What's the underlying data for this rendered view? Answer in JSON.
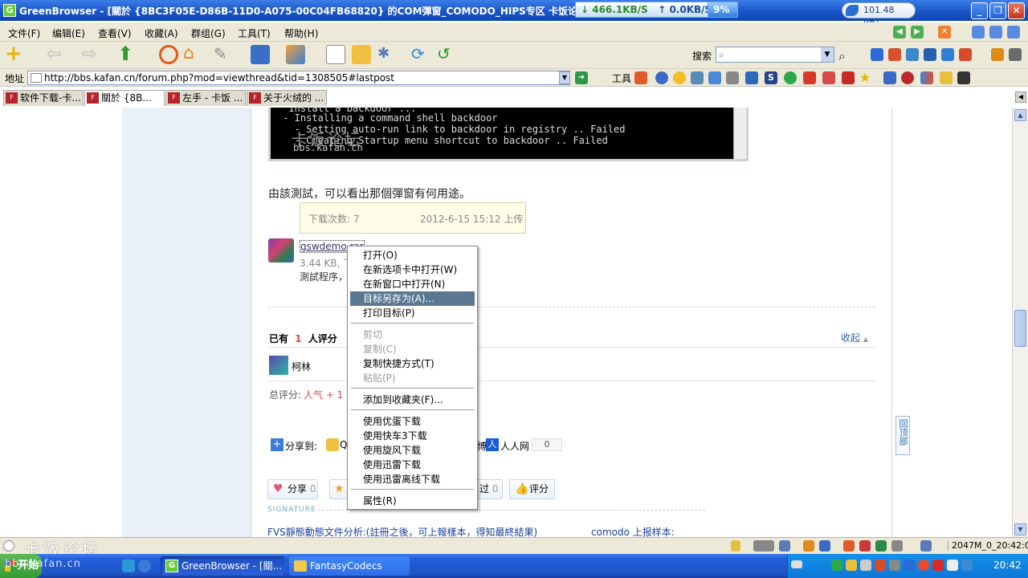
{
  "title_bar": {
    "text": "GreenBrowser - [關於 {8BC3F05E-D86B-11D0-A075-00C04FB68820} 的COM彈窗_COMODO_HIPS专区 卡饭论坛 - 互助分享,大",
    "download_speed": "↓ 466.1KB/S",
    "upload_speed": "↑ 0.0KB/S",
    "cpu": "9%",
    "net_meter": "101.48 KB/s"
  },
  "menu": [
    "文件(F)",
    "编辑(E)",
    "查看(V)",
    "收藏(A)",
    "群组(G)",
    "工具(T)",
    "帮助(H)"
  ],
  "search": {
    "label": "搜索",
    "value": ""
  },
  "address": {
    "label": "地址",
    "url": "http://bbs.kafan.cn/forum.php?mod=viewthread&tid=1308505#lastpost",
    "tools_label": "工具"
  },
  "tabs": [
    {
      "label": "软件下载-卡...",
      "active": false
    },
    {
      "label": "關於 {8B...",
      "active": true
    },
    {
      "label": "左手 - 卡饭 ...",
      "active": false
    },
    {
      "label": "关于火绒的 ...",
      "active": false
    }
  ],
  "console": {
    "lines": [
      "  Install a backdoor ...",
      " - Installing a command shell backdoor",
      "   - Setting auto-run link to backdoor in registry .. Failed",
      "   - Creating Startup menu shortcut to backdoor .. Failed"
    ],
    "watermark": "卡饭论坛",
    "watermark_url": "bbs.kafan.cn"
  },
  "post": {
    "text": "由該測試，可以看出那個彈窗有何用途。",
    "tooltip_downloads": "下载次数: 7",
    "tooltip_date": "2012-6-15 15:12 上传",
    "attachment_name": "gswdemo.rar",
    "attachment_meta": "3.44 KB, 下",
    "attachment_desc": "測試程序，"
  },
  "rating": {
    "prefix": "已有",
    "count": "1",
    "suffix": "人评分",
    "collapse": "收起",
    "user": "柯林",
    "total_label": "总评分:",
    "total_value": "人气 + 1"
  },
  "share": {
    "label": "分享到:",
    "qq": "Q",
    "partial": "博",
    "renren": "人人网",
    "renren_count": "0"
  },
  "actions": {
    "share": "分享",
    "share_count": "0",
    "pass_label": "过",
    "pass_count": "0",
    "rate": "评分"
  },
  "signature_label": "SIGNATURE",
  "footer_links": [
    "FVS靜態動態文件分析:(註冊之後，可上報樣本，得知最終結果)",
    "comodo 上报样本:"
  ],
  "back_to_top": "回顶部",
  "context_menu": [
    {
      "label": "打开(O)",
      "state": "normal"
    },
    {
      "label": "在新选项卡中打开(W)",
      "state": "normal"
    },
    {
      "label": "在新窗口中打开(N)",
      "state": "normal"
    },
    {
      "label": "目标另存为(A)...",
      "state": "highlighted"
    },
    {
      "label": "打印目标(P)",
      "state": "normal"
    },
    {
      "label": "剪切",
      "state": "disabled"
    },
    {
      "label": "复制(C)",
      "state": "disabled"
    },
    {
      "label": "复制快捷方式(T)",
      "state": "normal"
    },
    {
      "label": "粘贴(P)",
      "state": "disabled"
    },
    {
      "label": "添加到收藏夹(F)...",
      "state": "normal"
    },
    {
      "label": "使用优蛋下载",
      "state": "normal"
    },
    {
      "label": "使用快车3下载",
      "state": "normal"
    },
    {
      "label": "使用旋风下载",
      "state": "normal"
    },
    {
      "label": "使用迅雷下载",
      "state": "normal"
    },
    {
      "label": "使用迅雷离线下载",
      "state": "normal"
    },
    {
      "label": "属性(R)",
      "state": "normal"
    }
  ],
  "status": {
    "memory": "2047M_0_20:42:01"
  },
  "taskbar": {
    "start": "开始",
    "tasks": [
      "GreenBrowser - [關...",
      "FantasyCodecs"
    ],
    "clock": "20:42",
    "watermark": "卡饭论坛",
    "watermark_url": "bbs.kafan.cn"
  },
  "colors": {
    "accent": "#5a7891",
    "titlebar": "#1a55c8",
    "link": "#336699",
    "rating_red": "#e04444"
  }
}
